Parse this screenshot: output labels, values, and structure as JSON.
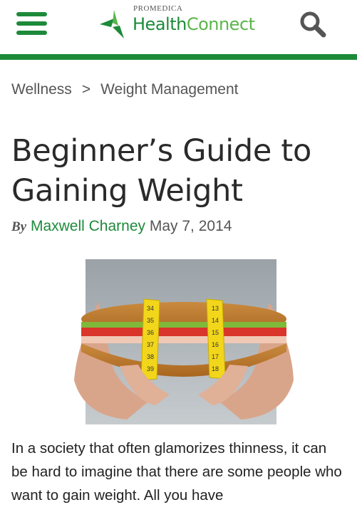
{
  "header": {
    "menu_icon": "hamburger-icon",
    "logo_pre": "PROMEDICA",
    "logo_health": "Health",
    "logo_connect": "Connect",
    "search_icon": "search-icon",
    "brand_green": "#1d8a3a"
  },
  "breadcrumb": {
    "items": [
      "Wellness",
      "Weight Management"
    ],
    "separator": ">"
  },
  "article": {
    "title": "Beginner’s Guide to Gaining Weight",
    "by_label": "By",
    "author": "Maxwell Charney",
    "date": "May 7, 2014",
    "tape_numbers_left": [
      "34",
      "35",
      "36",
      "37",
      "38",
      "39"
    ],
    "tape_numbers_right": [
      "13",
      "14",
      "15",
      "16",
      "17",
      "18"
    ],
    "body": "In a society that often glamorizes thinness, it can be hard to imagine that there are some people who want to gain weight. All you have"
  }
}
